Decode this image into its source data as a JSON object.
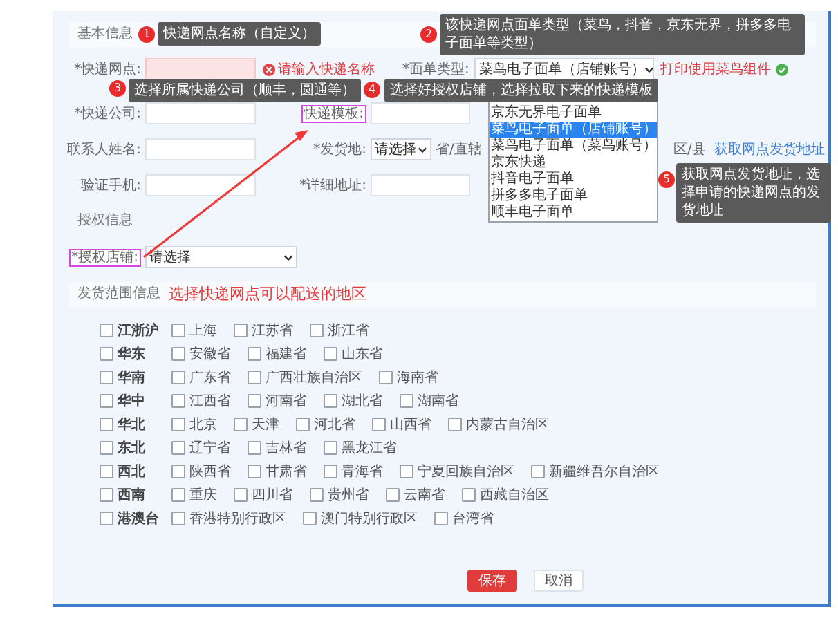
{
  "basic_info": {
    "title": "基本信息",
    "express_point": {
      "label": "*快递网点:",
      "error": "请输入快递名称"
    },
    "waybill_type": {
      "label": "*面单类型:",
      "value": "菜鸟电子面单（店铺账号）",
      "note": "打印使用菜鸟组件"
    },
    "express_company": {
      "label": "*快递公司:"
    },
    "template": {
      "label": "快递模板:"
    },
    "contact_name": {
      "label": "联系人姓名:"
    },
    "origin": {
      "label": "*发货地:",
      "province": "请选择",
      "city": "省/直辖",
      "district": "区/县",
      "link": "获取网点发货地址"
    },
    "phone": {
      "label": "验证手机:"
    },
    "address": {
      "label": "*详细地址:"
    }
  },
  "waybill_dropdown": {
    "options": [
      {
        "label": "京东无界电子面单",
        "selected": false
      },
      {
        "label": "菜鸟电子面单（店铺账号）",
        "selected": true
      },
      {
        "label": "菜鸟电子面单（菜鸟账号）",
        "selected": false
      },
      {
        "label": "京东快递",
        "selected": false
      },
      {
        "label": "抖音电子面单",
        "selected": false
      },
      {
        "label": "拼多多电子面单",
        "selected": false
      },
      {
        "label": "顺丰电子面单",
        "selected": false
      }
    ]
  },
  "auth_info": {
    "title": "授权信息",
    "shop": {
      "label": "*授权店铺:",
      "value": "请选择"
    }
  },
  "shipping_range": {
    "title": "发货范围信息",
    "hint": "选择快递网点可以配送的地区",
    "regions": [
      {
        "name": "江浙沪",
        "checked": false,
        "provinces": [
          {
            "name": "上海",
            "checked": false
          },
          {
            "name": "江苏省",
            "checked": false
          },
          {
            "name": "浙江省",
            "checked": false
          }
        ]
      },
      {
        "name": "华东",
        "checked": false,
        "provinces": [
          {
            "name": "安徽省",
            "checked": false
          },
          {
            "name": "福建省",
            "checked": false
          },
          {
            "name": "山东省",
            "checked": false
          }
        ]
      },
      {
        "name": "华南",
        "checked": false,
        "provinces": [
          {
            "name": "广东省",
            "checked": false
          },
          {
            "name": "广西壮族自治区",
            "checked": false
          },
          {
            "name": "海南省",
            "checked": false
          }
        ]
      },
      {
        "name": "华中",
        "checked": false,
        "provinces": [
          {
            "name": "江西省",
            "checked": false
          },
          {
            "name": "河南省",
            "checked": false
          },
          {
            "name": "湖北省",
            "checked": false
          },
          {
            "name": "湖南省",
            "checked": false
          }
        ]
      },
      {
        "name": "华北",
        "checked": false,
        "provinces": [
          {
            "name": "北京",
            "checked": false
          },
          {
            "name": "天津",
            "checked": false
          },
          {
            "name": "河北省",
            "checked": false
          },
          {
            "name": "山西省",
            "checked": false
          },
          {
            "name": "内蒙古自治区",
            "checked": false
          }
        ]
      },
      {
        "name": "东北",
        "checked": false,
        "provinces": [
          {
            "name": "辽宁省",
            "checked": false
          },
          {
            "name": "吉林省",
            "checked": false
          },
          {
            "name": "黑龙江省",
            "checked": false
          }
        ]
      },
      {
        "name": "西北",
        "checked": false,
        "provinces": [
          {
            "name": "陕西省",
            "checked": false
          },
          {
            "name": "甘肃省",
            "checked": false
          },
          {
            "name": "青海省",
            "checked": false
          },
          {
            "name": "宁夏回族自治区",
            "checked": false
          },
          {
            "name": "新疆维吾尔自治区",
            "checked": false
          }
        ]
      },
      {
        "name": "西南",
        "checked": false,
        "provinces": [
          {
            "name": "重庆",
            "checked": false
          },
          {
            "name": "四川省",
            "checked": false
          },
          {
            "name": "贵州省",
            "checked": false
          },
          {
            "name": "云南省",
            "checked": false
          },
          {
            "name": "西藏自治区",
            "checked": false
          }
        ]
      },
      {
        "name": "港澳台",
        "checked": false,
        "provinces": [
          {
            "name": "香港特别行政区",
            "checked": false
          },
          {
            "name": "澳门特别行政区",
            "checked": false
          },
          {
            "name": "台湾省",
            "checked": false
          }
        ]
      }
    ]
  },
  "buttons": [
    {
      "label": "保存",
      "kind": "primary"
    },
    {
      "label": "取消",
      "kind": "secondary"
    }
  ],
  "annotations": [
    {
      "number": "1",
      "text": "快递网点名称（自定义）"
    },
    {
      "number": "2",
      "text": "该快递网点面单类型（菜鸟，抖音，京东无界，拼多多电子面单等类型）"
    },
    {
      "number": "3",
      "text": "选择所属快递公司（顺丰，圆通等）"
    },
    {
      "number": "4",
      "text": "选择好授权店铺，选择拉取下来的快递模板"
    },
    {
      "number": "5",
      "text": "获取网点发货地址，选择申请的快递网点的发货地址"
    }
  ]
}
